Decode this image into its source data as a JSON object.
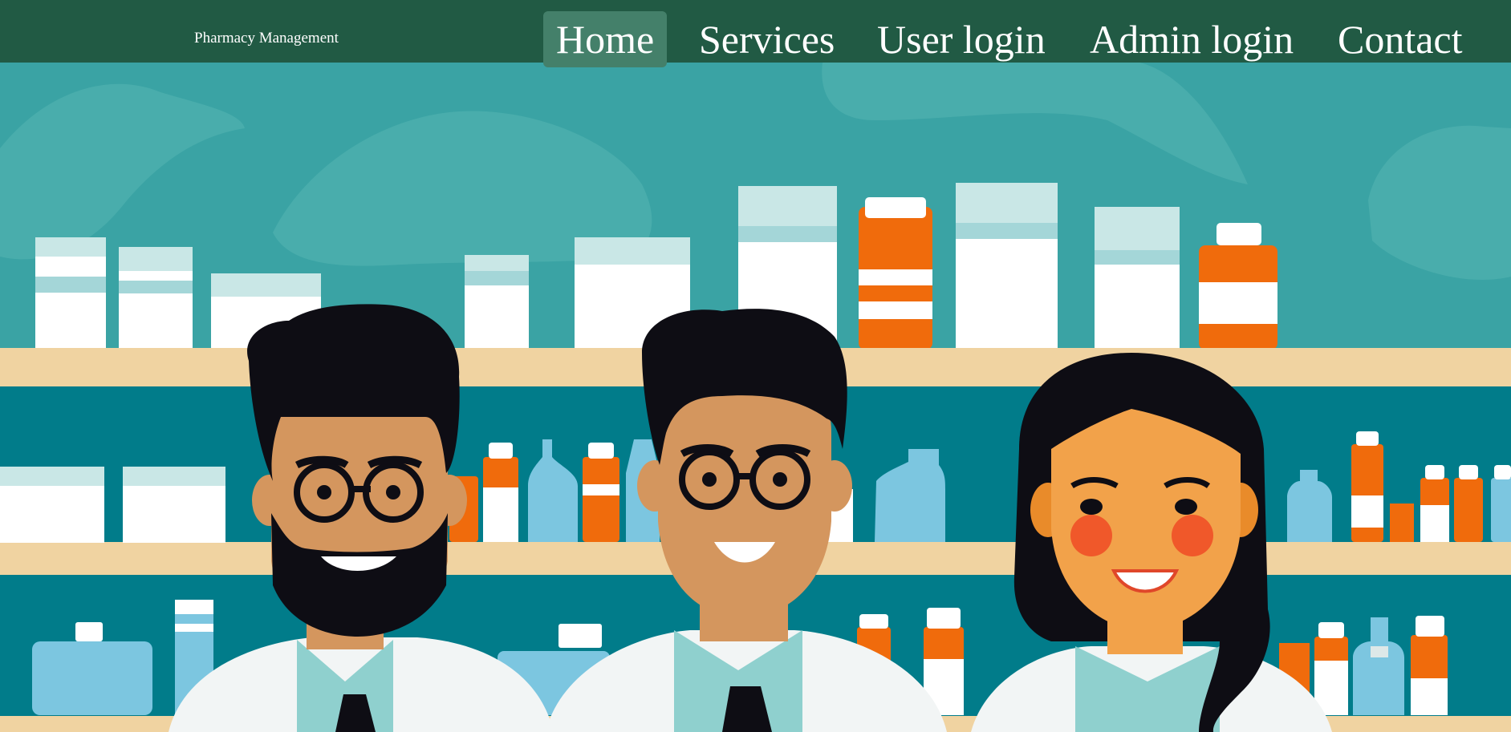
{
  "brand": {
    "title": "Pharmacy Management"
  },
  "nav": {
    "items": [
      {
        "label": "Home",
        "active": true
      },
      {
        "label": "Services",
        "active": false
      },
      {
        "label": "User login",
        "active": false
      },
      {
        "label": "Admin login",
        "active": false
      },
      {
        "label": "Contact",
        "active": false
      }
    ]
  },
  "hero": {
    "illustration": "three smiling pharmacists in white coats in front of medicine shelves"
  },
  "colors": {
    "navbar": "#215a44",
    "nav_active": "#44806a",
    "teal_background": "#3aa3a4",
    "shelf": "#f0d3a1",
    "shelf_back": "#017c8a",
    "bottle_orange": "#f06b0c"
  }
}
